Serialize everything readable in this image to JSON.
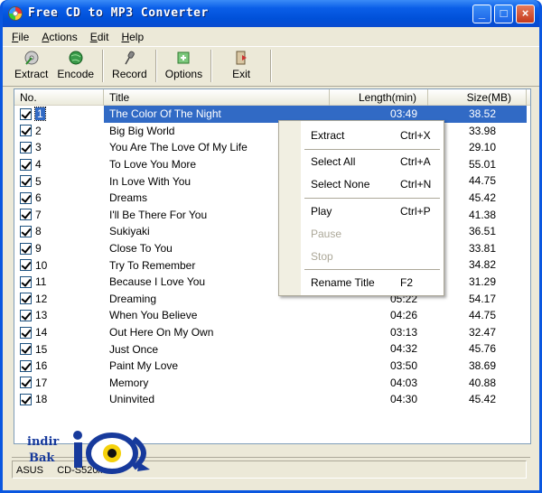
{
  "window": {
    "title": "Free CD to MP3 Converter",
    "controls": {
      "minimize": "_",
      "maximize": "□",
      "close": "×"
    }
  },
  "menubar": [
    {
      "label": "File",
      "accel": "F",
      "rest": "ile"
    },
    {
      "label": "Actions",
      "accel": "A",
      "rest": "ctions"
    },
    {
      "label": "Edit",
      "accel": "E",
      "rest": "dit"
    },
    {
      "label": "Help",
      "accel": "H",
      "rest": "elp"
    }
  ],
  "toolbar": {
    "extract": "Extract",
    "encode": "Encode",
    "record": "Record",
    "options": "Options",
    "exit": "Exit"
  },
  "columns": {
    "no": "No.",
    "title": "Title",
    "length": "Length(min)",
    "size": "Size(MB)"
  },
  "tracks": [
    {
      "no": "1",
      "title": "The Color Of The Night",
      "length": "03:49",
      "size": "38.52",
      "checked": true,
      "selected": true
    },
    {
      "no": "2",
      "title": "Big Big World",
      "length": "",
      "size": "33.98",
      "checked": true
    },
    {
      "no": "3",
      "title": "You Are The Love Of My Life",
      "length": "",
      "size": "29.10",
      "checked": true
    },
    {
      "no": "4",
      "title": "To Love You More",
      "length": "",
      "size": "55.01",
      "checked": true
    },
    {
      "no": "5",
      "title": "In Love With You",
      "length": "",
      "size": "44.75",
      "checked": true
    },
    {
      "no": "6",
      "title": "Dreams",
      "length": "",
      "size": "45.42",
      "checked": true
    },
    {
      "no": "7",
      "title": "I'll Be There For You",
      "length": "",
      "size": "41.38",
      "checked": true
    },
    {
      "no": "8",
      "title": "Sukiyaki",
      "length": "",
      "size": "36.51",
      "checked": true
    },
    {
      "no": "9",
      "title": "Close To You",
      "length": "",
      "size": "33.81",
      "checked": true
    },
    {
      "no": "10",
      "title": "Try To Remember",
      "length": "",
      "size": "34.82",
      "checked": true
    },
    {
      "no": "11",
      "title": "Because I Love You",
      "length": "",
      "size": "31.29",
      "checked": true
    },
    {
      "no": "12",
      "title": "Dreaming",
      "length": "05:22",
      "size": "54.17",
      "checked": true
    },
    {
      "no": "13",
      "title": "When You Believe",
      "length": "04:26",
      "size": "44.75",
      "checked": true
    },
    {
      "no": "14",
      "title": "Out Here On My Own",
      "length": "03:13",
      "size": "32.47",
      "checked": true
    },
    {
      "no": "15",
      "title": "Just Once",
      "length": "04:32",
      "size": "45.76",
      "checked": true
    },
    {
      "no": "16",
      "title": "Paint My Love",
      "length": "03:50",
      "size": "38.69",
      "checked": true
    },
    {
      "no": "17",
      "title": "Memory",
      "length": "04:03",
      "size": "40.88",
      "checked": true
    },
    {
      "no": "18",
      "title": "Uninvited",
      "length": "04:30",
      "size": "45.42",
      "checked": true
    }
  ],
  "context_menu": {
    "extract": {
      "label": "Extract",
      "shortcut": "Ctrl+X"
    },
    "select_all": {
      "label": "Select All",
      "shortcut": "Ctrl+A"
    },
    "select_none": {
      "label": "Select None",
      "shortcut": "Ctrl+N"
    },
    "play": {
      "label": "Play",
      "shortcut": "Ctrl+P"
    },
    "pause": {
      "label": "Pause",
      "shortcut": ""
    },
    "stop": {
      "label": "Stop",
      "shortcut": ""
    },
    "rename_title": {
      "label": "Rename Title",
      "shortcut": "F2"
    }
  },
  "statusbar": {
    "drive": "ASUS     CD-S520/A"
  },
  "watermark": {
    "line1": "indir",
    "line2": "Bak"
  },
  "colors": {
    "titlebar": "#0a5ee8",
    "selection": "#316ac5",
    "face": "#ece9d8"
  }
}
